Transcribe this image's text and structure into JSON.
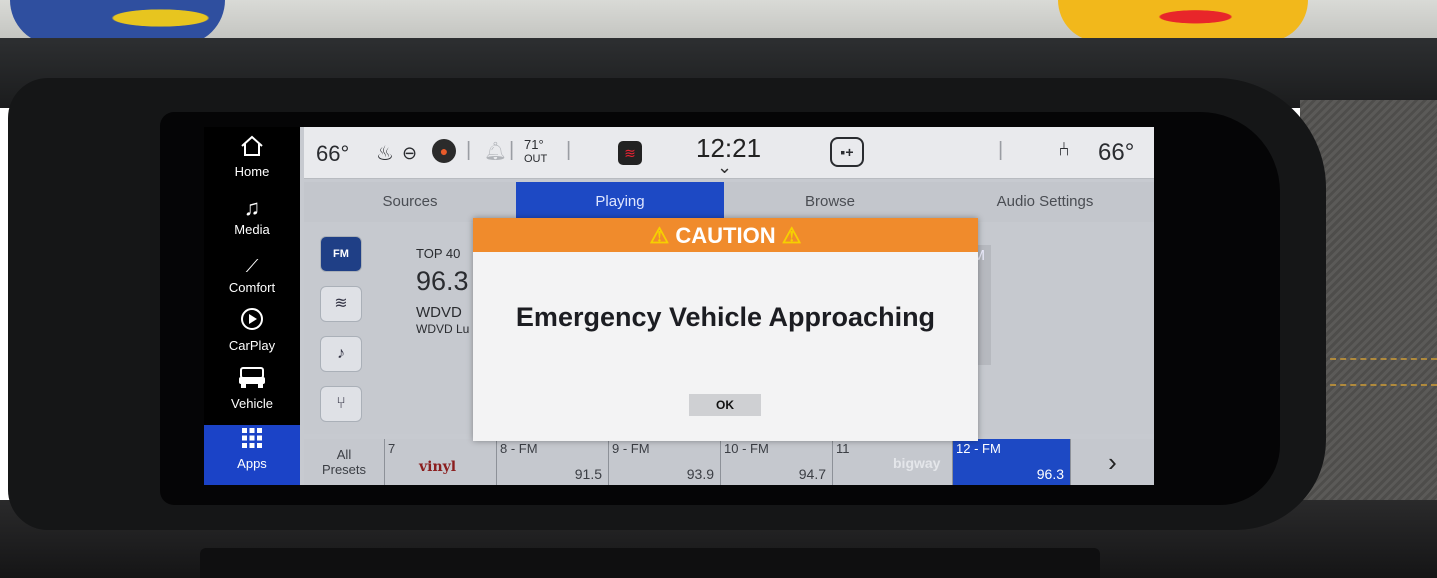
{
  "sidebar": {
    "items": [
      {
        "label": "Home",
        "icon": "home-icon"
      },
      {
        "label": "Media",
        "icon": "music-note-icon"
      },
      {
        "label": "Comfort",
        "icon": "seat-comfort-icon"
      },
      {
        "label": "CarPlay",
        "icon": "carplay-icon"
      },
      {
        "label": "Vehicle",
        "icon": "vehicle-icon"
      },
      {
        "label": "Apps",
        "icon": "apps-grid-icon",
        "active": true
      }
    ]
  },
  "status": {
    "temp_left": "66°",
    "outside_temp": "71°",
    "outside_label": "OUT",
    "time": "12:21",
    "temp_right": "66°"
  },
  "tabs": [
    {
      "label": "Sources"
    },
    {
      "label": "Playing",
      "active": true
    },
    {
      "label": "Browse"
    },
    {
      "label": "Audio Settings"
    }
  ],
  "now_playing": {
    "category": "TOP 40",
    "frequency": "96.3",
    "station": "WDVD",
    "station_sub": "WDVD Lu",
    "band_label": "FM"
  },
  "sources": {
    "fm_label": "FM"
  },
  "presets": [
    {
      "label": "All\nPresets"
    },
    {
      "num": "7",
      "logo": "vinyl",
      "freq": ""
    },
    {
      "num": "8 - FM",
      "freq": "91.5"
    },
    {
      "num": "9 - FM",
      "freq": "93.9"
    },
    {
      "num": "10 - FM",
      "freq": "94.7"
    },
    {
      "num": "11",
      "logo": "bigway",
      "freq": ""
    },
    {
      "num": "12 - FM",
      "freq": "96.3",
      "active": true
    }
  ],
  "dialog": {
    "title": "CAUTION",
    "message": "Emergency Vehicle Approaching",
    "ok_label": "OK"
  },
  "colors": {
    "accent_blue": "#1d49c4",
    "caution_orange": "#f08b2c",
    "warning_yellow": "#f6d000"
  }
}
